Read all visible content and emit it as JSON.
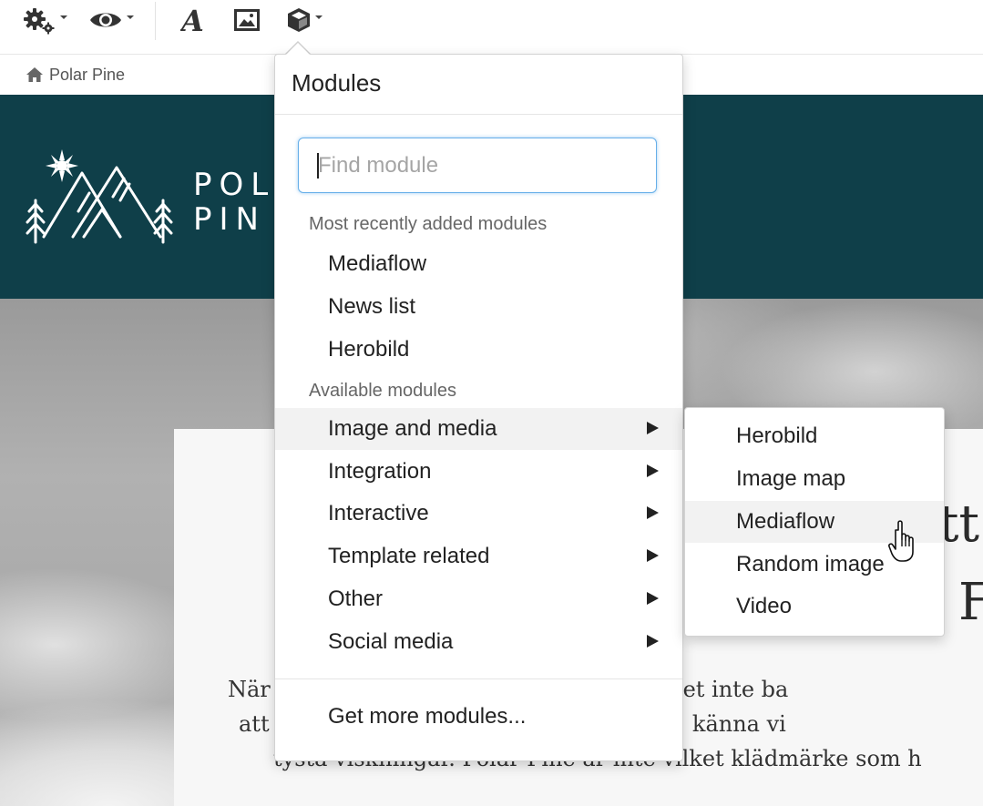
{
  "toolbar": {
    "icons": [
      "gears-icon",
      "eye-icon",
      "text-style-icon",
      "image-icon",
      "cube-icon"
    ]
  },
  "breadcrumb": {
    "home_label": "Polar Pine"
  },
  "site": {
    "logo_line1": "POL",
    "logo_line2": "PIN",
    "logo_icons": [
      "sun-icon",
      "mountain-icon",
      "pine-tree-icon"
    ]
  },
  "hero": {
    "heading_line1": "tt",
    "heading_line2": "F",
    "text_lines": [
      "När                                   Pine, handlar det inte ba",
      "att                                   n omfamna dig, känna vi",
      "tysta viskningar. Polar Pine är inte vilket klädmärke som h"
    ]
  },
  "modules_menu": {
    "title": "Modules",
    "search": {
      "placeholder": "Find module",
      "value": ""
    },
    "recent_label": "Most recently added modules",
    "recent_items": [
      "Mediaflow",
      "News list",
      "Herobild"
    ],
    "available_label": "Available modules",
    "categories": [
      {
        "label": "Image and media",
        "active": true
      },
      {
        "label": "Integration"
      },
      {
        "label": "Interactive"
      },
      {
        "label": "Template related"
      },
      {
        "label": "Other"
      },
      {
        "label": "Social media"
      }
    ],
    "footer_link": "Get more modules..."
  },
  "submenu": {
    "items": [
      "Herobild",
      "Image map",
      "Mediaflow",
      "Random image",
      "Video"
    ],
    "hovered": "Mediaflow"
  },
  "colors": {
    "header_bg": "#0f3f49",
    "focus_border": "#66afe9",
    "active_bg": "#f2f2f2"
  }
}
